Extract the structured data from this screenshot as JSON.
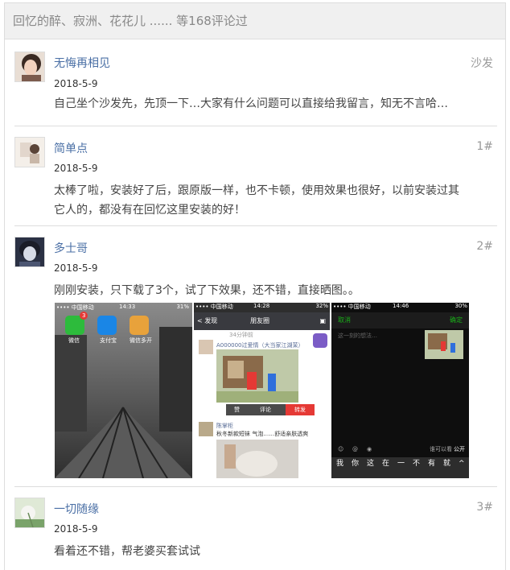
{
  "header": {
    "title": "回忆的醉、寂洲、花花儿 ...... 等168评论过"
  },
  "comments": [
    {
      "name": "无悔再相见",
      "floor": "沙发",
      "date": "2018-5-9",
      "text": "自己坐个沙发先，先顶一下…大家有什么问题可以直接给我留言，知无不言哈…"
    },
    {
      "name": "简单点",
      "floor": "1#",
      "date": "2018-5-9",
      "text_lines": [
        "太棒了啦，安装好了后，跟原版一样，也不卡顿，使用效果也很好，以前安装过其",
        "它人的，都没有在回忆这里安装的好！"
      ]
    },
    {
      "name": "多士哥",
      "floor": "2#",
      "date": "2018-5-9",
      "text": "刚刚安装，只下载了3个，试了下效果，还不错，直接晒图。。"
    },
    {
      "name": "一切随缘",
      "floor": "3#",
      "date": "2018-5-9",
      "text": "看着还不错，帮老婆买套试试"
    }
  ],
  "screenshots": {
    "shot1": {
      "carrier": "•••• 中国移动",
      "time": "14:33",
      "battery": "31%",
      "badge": "3",
      "apps": [
        "微信",
        "支付宝",
        "微信多开"
      ]
    },
    "shot2": {
      "carrier": "•••• 中国移动",
      "time": "14:28",
      "battery": "32%",
      "back": "< 发现",
      "title": "朋友圈",
      "post_time": "34分钟前",
      "user1": "A000000过爱情（大当家江湖茉）",
      "actions": [
        "赞",
        "评论",
        "转发"
      ],
      "user2": "陈掌柜",
      "user2_text": "秋冬新款短袜 气泡……舒适亲肤透爽"
    },
    "shot3": {
      "carrier": "•••• 中国移动",
      "time": "14:46",
      "battery": "30%",
      "cancel": "取消",
      "send": "确定",
      "placeholder": "这一刻的想法…",
      "tool_text": "谁可以看",
      "public": "公开",
      "keyboard": [
        "我",
        "你",
        "这",
        "在",
        "一",
        "不",
        "有",
        "就",
        "^"
      ]
    }
  }
}
